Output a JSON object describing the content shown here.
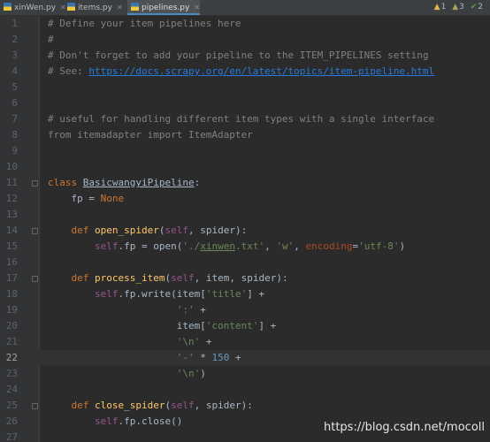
{
  "tabs": [
    {
      "label": "xinWen.py",
      "active": false
    },
    {
      "label": "items.py",
      "active": false
    },
    {
      "label": "pipelines.py",
      "active": true
    }
  ],
  "inspections": {
    "warnings": "1",
    "weak_warnings": "3",
    "typos": "2",
    "warning_color": "#e5b454",
    "weak_warning_color": "#a5a35b",
    "typo_color": "#5a9e3b"
  },
  "current_line": 22,
  "lines": [
    {
      "n": "1",
      "tokens": [
        {
          "t": "# Define your item pipelines here",
          "c": "comment"
        }
      ]
    },
    {
      "n": "2",
      "tokens": [
        {
          "t": "#",
          "c": "comment"
        }
      ]
    },
    {
      "n": "3",
      "tokens": [
        {
          "t": "# Don't forget to add your pipeline to the ITEM_PIPELINES setting",
          "c": "comment"
        }
      ]
    },
    {
      "n": "4",
      "tokens": [
        {
          "t": "# See: ",
          "c": "comment"
        },
        {
          "t": "https://docs.scrapy.org/en/latest/topics/item-pipeline.html",
          "c": "link"
        }
      ]
    },
    {
      "n": "5",
      "tokens": []
    },
    {
      "n": "6",
      "tokens": []
    },
    {
      "n": "7",
      "tokens": [
        {
          "t": "# useful for handling different item types with a single interface",
          "c": "comment"
        }
      ]
    },
    {
      "n": "8",
      "tokens": [
        {
          "t": "from itemadapter import ItemAdapter",
          "c": "comment"
        }
      ]
    },
    {
      "n": "9",
      "tokens": []
    },
    {
      "n": "10",
      "tokens": []
    },
    {
      "n": "11",
      "tokens": [
        {
          "t": "class ",
          "c": "kw"
        },
        {
          "t": "BasicwangyiPipeline",
          "c": "under"
        },
        {
          "t": ":",
          "c": "plain"
        }
      ]
    },
    {
      "n": "12",
      "tokens": [
        {
          "t": "    fp = ",
          "c": "plain"
        },
        {
          "t": "None",
          "c": "kw"
        }
      ]
    },
    {
      "n": "13",
      "tokens": []
    },
    {
      "n": "14",
      "tokens": [
        {
          "t": "    ",
          "c": "plain"
        },
        {
          "t": "def ",
          "c": "kw"
        },
        {
          "t": "open_spider",
          "c": "fn"
        },
        {
          "t": "(",
          "c": "plain"
        },
        {
          "t": "self",
          "c": "self"
        },
        {
          "t": ", ",
          "c": "plain"
        },
        {
          "t": "spider",
          "c": "plain"
        },
        {
          "t": "):",
          "c": "plain"
        }
      ]
    },
    {
      "n": "15",
      "tokens": [
        {
          "t": "        ",
          "c": "plain"
        },
        {
          "t": "self",
          "c": "self"
        },
        {
          "t": ".fp = ",
          "c": "plain"
        },
        {
          "t": "open",
          "c": "plain"
        },
        {
          "t": "(",
          "c": "plain"
        },
        {
          "t": "'./",
          "c": "str"
        },
        {
          "t": "xinwen",
          "c": "str-under"
        },
        {
          "t": ".txt'",
          "c": "str"
        },
        {
          "t": ", ",
          "c": "plain"
        },
        {
          "t": "'w'",
          "c": "str"
        },
        {
          "t": ", ",
          "c": "plain"
        },
        {
          "t": "encoding",
          "c": "kwarg"
        },
        {
          "t": "=",
          "c": "plain"
        },
        {
          "t": "'utf-8'",
          "c": "str"
        },
        {
          "t": ")",
          "c": "plain"
        }
      ]
    },
    {
      "n": "16",
      "tokens": []
    },
    {
      "n": "17",
      "tokens": [
        {
          "t": "    ",
          "c": "plain"
        },
        {
          "t": "def ",
          "c": "kw"
        },
        {
          "t": "process_item",
          "c": "fn"
        },
        {
          "t": "(",
          "c": "plain"
        },
        {
          "t": "self",
          "c": "self"
        },
        {
          "t": ", ",
          "c": "plain"
        },
        {
          "t": "item",
          "c": "plain"
        },
        {
          "t": ", ",
          "c": "plain"
        },
        {
          "t": "spider",
          "c": "plain"
        },
        {
          "t": "):",
          "c": "plain"
        }
      ]
    },
    {
      "n": "18",
      "tokens": [
        {
          "t": "        ",
          "c": "plain"
        },
        {
          "t": "self",
          "c": "self"
        },
        {
          "t": ".fp.write(item[",
          "c": "plain"
        },
        {
          "t": "'title'",
          "c": "str"
        },
        {
          "t": "] +",
          "c": "plain"
        }
      ]
    },
    {
      "n": "19",
      "tokens": [
        {
          "t": "                      ",
          "c": "plain"
        },
        {
          "t": "':'",
          "c": "str"
        },
        {
          "t": " +",
          "c": "plain"
        }
      ]
    },
    {
      "n": "20",
      "tokens": [
        {
          "t": "                      item[",
          "c": "plain"
        },
        {
          "t": "'content'",
          "c": "str"
        },
        {
          "t": "] +",
          "c": "plain"
        }
      ]
    },
    {
      "n": "21",
      "tokens": [
        {
          "t": "                      ",
          "c": "plain"
        },
        {
          "t": "'\\n'",
          "c": "str"
        },
        {
          "t": " +",
          "c": "plain"
        }
      ]
    },
    {
      "n": "22",
      "tokens": [
        {
          "t": "                      ",
          "c": "plain"
        },
        {
          "t": "'-'",
          "c": "str"
        },
        {
          "t": " * ",
          "c": "plain"
        },
        {
          "t": "150",
          "c": "num"
        },
        {
          "t": " +",
          "c": "plain"
        }
      ]
    },
    {
      "n": "23",
      "tokens": [
        {
          "t": "                      ",
          "c": "plain"
        },
        {
          "t": "'\\n'",
          "c": "str"
        },
        {
          "t": ")",
          "c": "plain"
        }
      ]
    },
    {
      "n": "24",
      "tokens": []
    },
    {
      "n": "25",
      "tokens": [
        {
          "t": "    ",
          "c": "plain"
        },
        {
          "t": "def ",
          "c": "kw"
        },
        {
          "t": "close_spider",
          "c": "fn"
        },
        {
          "t": "(",
          "c": "plain"
        },
        {
          "t": "self",
          "c": "self"
        },
        {
          "t": ", ",
          "c": "plain"
        },
        {
          "t": "spider",
          "c": "plain"
        },
        {
          "t": "):",
          "c": "plain"
        }
      ]
    },
    {
      "n": "26",
      "tokens": [
        {
          "t": "        ",
          "c": "plain"
        },
        {
          "t": "self",
          "c": "self"
        },
        {
          "t": ".fp.close()",
          "c": "plain"
        }
      ]
    },
    {
      "n": "27",
      "tokens": []
    }
  ],
  "watermark": "https://blog.csdn.net/mocoll"
}
